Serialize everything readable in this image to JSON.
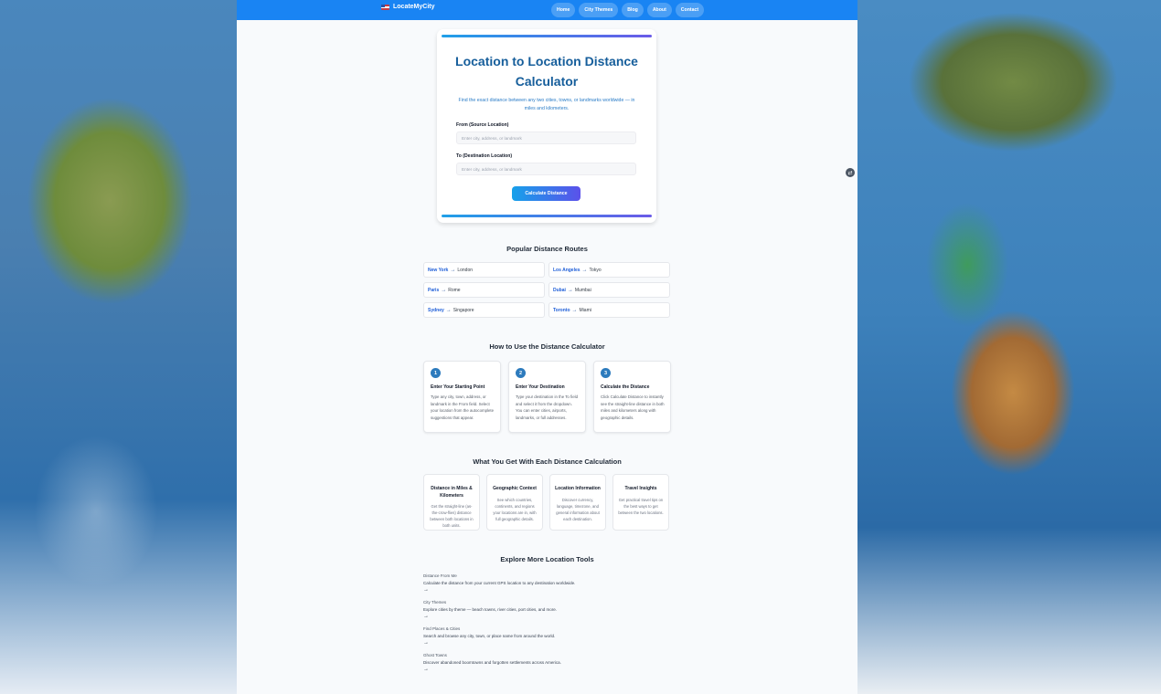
{
  "nav": {
    "brand": "LocateMyCity",
    "links": [
      "Home",
      "City Themes",
      "Blog",
      "About",
      "Contact"
    ]
  },
  "hero": {
    "title": "Location to Location Distance Calculator",
    "subtitle": "Find the exact distance between any two cities, towns, or landmarks worldwide — in miles and kilometers.",
    "from_label": "From (Source Location)",
    "to_label": "To (Destination Location)",
    "from_placeholder": "Enter city, address, or landmark",
    "to_placeholder": "Enter city, address, or landmark",
    "button": "Calculate Distance"
  },
  "popular_routes": {
    "title": "Popular Distance Routes",
    "items": [
      {
        "from": "New York",
        "to": "London"
      },
      {
        "from": "Los Angeles",
        "to": "Tokyo"
      },
      {
        "from": "Paris",
        "to": "Rome"
      },
      {
        "from": "Dubai",
        "to": "Mumbai"
      },
      {
        "from": "Sydney",
        "to": "Singapore"
      },
      {
        "from": "Toronto",
        "to": "Miami"
      }
    ]
  },
  "how_to": {
    "title": "How to Use the Distance Calculator",
    "steps": [
      {
        "num": "1",
        "title": "Enter Your Starting Point",
        "desc": "Type any city, town, address, or landmark in the From field. Select your location from the autocomplete suggestions that appear."
      },
      {
        "num": "2",
        "title": "Enter Your Destination",
        "desc": "Type your destination in the To field and select it from the dropdown. You can enter cities, airports, landmarks, or full addresses."
      },
      {
        "num": "3",
        "title": "Calculate the Distance",
        "desc": "Click Calculate Distance to instantly see the straight-line distance in both miles and kilometers along with geographic details."
      }
    ]
  },
  "features": {
    "title": "What You Get With Each Distance Calculation",
    "items": [
      {
        "title": "Distance in Miles & Kilometers",
        "desc": "Get the straight-line (as-the-crow-flies) distance between both locations in both units."
      },
      {
        "title": "Geographic Context",
        "desc": "See which countries, continents, and regions your locations are in, with full geographic details."
      },
      {
        "title": "Location Information",
        "desc": "Discover currency, language, timezone, and general information about each destination."
      },
      {
        "title": "Travel Insights",
        "desc": "Get practical travel tips on the best ways to get between the two locations."
      }
    ]
  },
  "tools": {
    "title": "Explore More Location Tools",
    "items": [
      {
        "name": "Distance From Me",
        "desc": "Calculate the distance from your current GPS location to any destination worldwide.",
        "arrow": "→"
      },
      {
        "name": "City Themes",
        "desc": "Explore cities by theme — beach towns, river cities, port cities, and more.",
        "arrow": "→"
      },
      {
        "name": "Find Places & Cities",
        "desc": "Search and browse any city, town, or place name from around the world.",
        "arrow": "→"
      },
      {
        "name": "Ghost Towns",
        "desc": "Discover abandoned boomtowns and forgotten settlements across America.",
        "arrow": "→"
      }
    ]
  },
  "floating": {
    "icon": "language-toggle-icon"
  },
  "colors": {
    "nav": "#1984f3",
    "title": "#165e9b",
    "accent": "#4f63e8"
  }
}
